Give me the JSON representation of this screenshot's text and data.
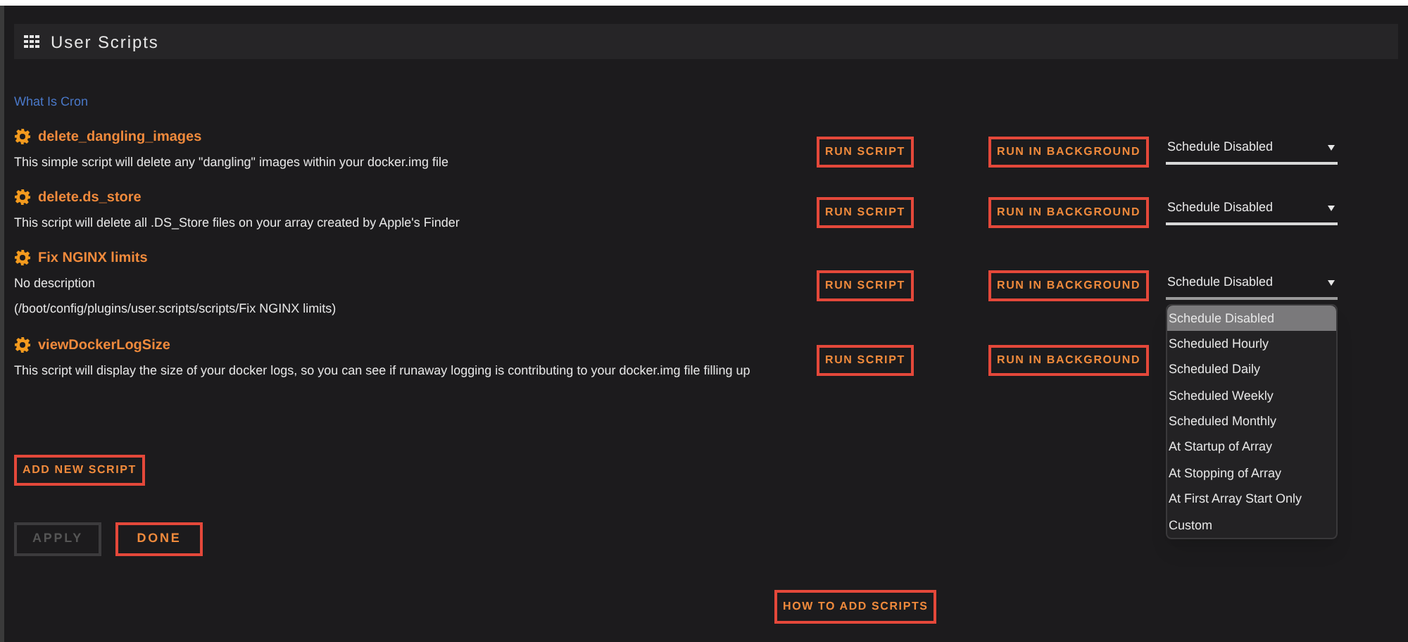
{
  "header": {
    "title": "User Scripts"
  },
  "cron_link": "What Is Cron",
  "scripts": [
    {
      "name": "delete_dangling_images",
      "description": "This simple script will delete any \"dangling\" images within your docker.img file",
      "run": "RUN SCRIPT",
      "background": "RUN IN BACKGROUND",
      "schedule": {
        "value": "Schedule Disabled",
        "open": false
      }
    },
    {
      "name": "delete.ds_store",
      "description": "This script will delete all .DS_Store files on your array created by Apple's Finder",
      "run": "RUN SCRIPT",
      "background": "RUN IN BACKGROUND",
      "schedule": {
        "value": "Schedule Disabled",
        "open": false
      }
    },
    {
      "name": "Fix NGINX limits",
      "description": "No description",
      "path": "(/boot/config/plugins/user.scripts/scripts/Fix NGINX limits)",
      "run": "RUN SCRIPT",
      "background": "RUN IN BACKGROUND",
      "schedule": {
        "value": "Schedule Disabled",
        "open": true,
        "options": [
          {
            "label": "Schedule Disabled",
            "selected": true
          },
          {
            "label": "Scheduled Hourly",
            "selected": false
          },
          {
            "label": "Scheduled Daily",
            "selected": false
          },
          {
            "label": "Scheduled Weekly",
            "selected": false
          },
          {
            "label": "Scheduled Monthly",
            "selected": false
          },
          {
            "label": "At Startup of Array",
            "selected": false
          },
          {
            "label": "At Stopping of Array",
            "selected": false
          },
          {
            "label": "At First Array Start Only",
            "selected": false
          },
          {
            "label": "Custom",
            "selected": false
          }
        ]
      }
    },
    {
      "name": "viewDockerLogSize",
      "description": "This script will display the size of your docker logs, so you can see if runaway logging is contributing to your docker.img file filling up",
      "run": "RUN SCRIPT",
      "background": "RUN IN BACKGROUND"
    }
  ],
  "add_button": "ADD NEW SCRIPT",
  "actions": [
    {
      "label": "APPLY",
      "disabled": true
    },
    {
      "label": "DONE",
      "disabled": false
    }
  ],
  "help_button": "HOW TO ADD SCRIPTS"
}
